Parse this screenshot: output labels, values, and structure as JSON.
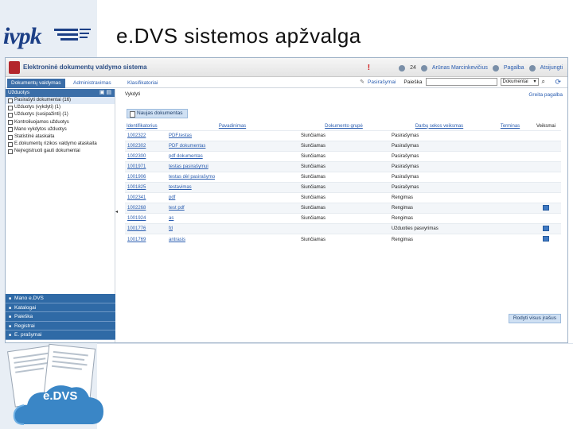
{
  "slide": {
    "title": "e.DVS  sistemos apžvalga",
    "logo_text": "ivpk",
    "illustration_label": "e.DVS"
  },
  "app": {
    "title": "Elektroninė dokumentų valdymo sistema",
    "user_name": "Arūnas Marcinkevičius",
    "help_link": "Pagalba",
    "logout_link": "Atsijungti",
    "user_code": "24",
    "nav_tabs": [
      {
        "label": "Dokumentų valdymas",
        "active": true
      },
      {
        "label": "Administravimas",
        "active": false
      },
      {
        "label": "Klasifikatoriai",
        "active": false
      }
    ],
    "signing_label": "Pasirašymai",
    "search_label": "Paieška",
    "search_value": "",
    "search_scope": "Dokumentai"
  },
  "sidebar": {
    "header": "Užduotys",
    "items": [
      "Pasirašyti dokumentai (16)",
      "Užduotys (vykdyti) (1)",
      "Užduotys (susipažinti) (1)",
      "Kontroliuojamos užduotys",
      "Mano vykdytos užduotys",
      "Statistinė ataskaita",
      "E.dokumentų rizikos valdymo ataskaita",
      "Neįregistruoti gauti dokumentai"
    ],
    "sections": [
      "Mano e.DVS",
      "Katalogai",
      "Paieška",
      "Registrai",
      "E. prašymai"
    ],
    "collapse_glyph": "◂"
  },
  "main": {
    "breadcrumb": "Vykdyti",
    "quick_help": "Greita pagalba",
    "new_doc_button": "Naujas dokumentas",
    "show_all_button": "Rodyti visus įrašus",
    "columns": [
      "Identifikatorius",
      "Pavadinimas",
      "Dokumento grupė",
      "Darbų sekos veiksmas",
      "Terminas",
      "Veiksmai"
    ],
    "rows": [
      {
        "id": "1002322",
        "title": "PDF.testas",
        "group": "Siunčiamas",
        "step": "Pasirašymas",
        "due": "",
        "action": false
      },
      {
        "id": "1002302",
        "title": "PDF dokumentas",
        "group": "Siunčiamas",
        "step": "Pasirašymas",
        "due": "",
        "action": false
      },
      {
        "id": "1002300",
        "title": "pdf dokumentas",
        "group": "Siunčiamas",
        "step": "Pasirašymas",
        "due": "",
        "action": false
      },
      {
        "id": "1001971",
        "title": "testas pasirašymui",
        "group": "Siunčiamas",
        "step": "Pasirašymas",
        "due": "",
        "action": false
      },
      {
        "id": "1001906",
        "title": "testas dėl pasirašymo",
        "group": "Siunčiamas",
        "step": "Pasirašymas",
        "due": "",
        "action": false
      },
      {
        "id": "1001825",
        "title": "testavimas",
        "group": "Siunčiamas",
        "step": "Pasirašymas",
        "due": "",
        "action": false
      },
      {
        "id": "1002341",
        "title": "pdf",
        "group": "Siunčiamas",
        "step": "Rengimas",
        "due": "",
        "action": false
      },
      {
        "id": "1002268",
        "title": "test pdf",
        "group": "Siunčiamas",
        "step": "Rengimas",
        "due": "",
        "action": true
      },
      {
        "id": "1001924",
        "title": "as",
        "group": "Siunčiamas",
        "step": "Rengimas",
        "due": "",
        "action": false
      },
      {
        "id": "1001776",
        "title": "fd",
        "group": "",
        "step": "Užduoties pasvyrimas",
        "due": "",
        "action": true
      },
      {
        "id": "1001769",
        "title": "antrasis",
        "group": "Siunčiamas",
        "step": "Rengimas",
        "due": "",
        "action": true
      }
    ]
  },
  "colors": {
    "brand_blue": "#2f6aa6",
    "link_blue": "#2a5db0",
    "alert_red": "#d01a1a",
    "left_band": "#e8eef5"
  }
}
